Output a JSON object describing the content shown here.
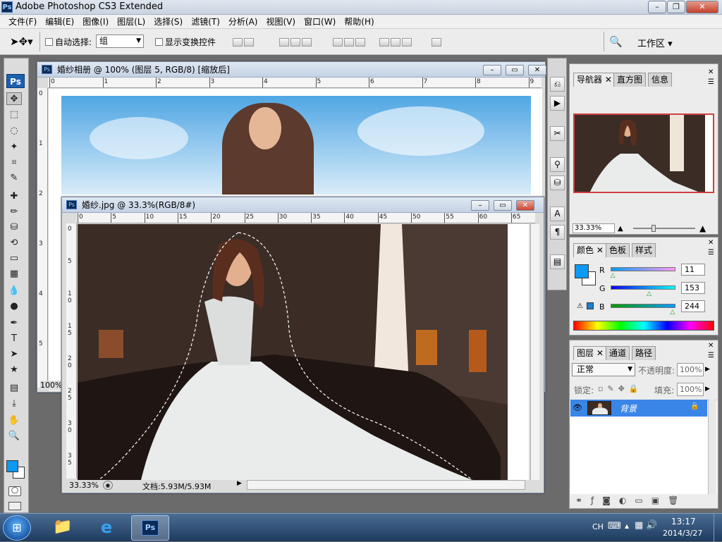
{
  "window": {
    "app_title": "Adobe Photoshop CS3 Extended",
    "logo_text": "Ps"
  },
  "menu": [
    "文件(F)",
    "编辑(E)",
    "图像(I)",
    "图层(L)",
    "选择(S)",
    "滤镜(T)",
    "分析(A)",
    "视图(V)",
    "窗口(W)",
    "帮助(H)"
  ],
  "options": {
    "auto_select_label": "自动选择:",
    "auto_select_value": "组",
    "show_transform_label": "显示变换控件",
    "workspace_label": "工作区"
  },
  "toolbox": {
    "badge": "Ps",
    "icons": [
      "move-tool-icon",
      "marquee-tool-icon",
      "lasso-tool-icon",
      "magic-wand-icon",
      "crop-tool-icon",
      "slice-tool-icon",
      "healing-brush-icon",
      "brush-tool-icon",
      "clone-stamp-icon",
      "history-brush-icon",
      "eraser-icon",
      "gradient-tool-icon",
      "blur-tool-icon",
      "dodge-tool-icon",
      "pen-tool-icon",
      "type-tool-icon",
      "path-select-icon",
      "shape-tool-icon",
      "notes-tool-icon",
      "eyedropper-icon",
      "hand-tool-icon",
      "zoom-tool-icon"
    ],
    "glyphs": [
      "✥",
      "⬚",
      "◌",
      "✦",
      "⌗",
      "✎",
      "✚",
      "✏",
      "⛁",
      "⟲",
      "▭",
      "▦",
      "💧",
      "●",
      "✒",
      "T",
      "➤",
      "★",
      "▤",
      "⤓",
      "✋",
      "🔍"
    ],
    "foreground_color": "#0b99f4",
    "background_color": "#ffffff"
  },
  "doc1": {
    "title": "婚纱相册 @ 100% (图层 5, RGB/8) [缩放后]",
    "zoom": "100%",
    "ruler_h": [
      "0",
      "1",
      "2",
      "3",
      "4",
      "5",
      "6",
      "7",
      "8",
      "9"
    ],
    "ruler_v": [
      "0",
      "1",
      "2",
      "3",
      "4",
      "5"
    ]
  },
  "doc2": {
    "title": "婚纱.jpg @ 33.3%(RGB/8#)",
    "zoom": "33.33%",
    "doc_info": "文档:5.93M/5.93M",
    "ruler_h": [
      "0",
      "5",
      "10",
      "15",
      "20",
      "25",
      "30",
      "35",
      "40",
      "45",
      "50",
      "55",
      "60",
      "65"
    ],
    "ruler_v": [
      "0",
      "5",
      "10",
      "15",
      "20",
      "25",
      "30",
      "35"
    ]
  },
  "navigator": {
    "tabs": [
      "导航器",
      "直方图",
      "信息"
    ],
    "zoom": "33.33%"
  },
  "color_panel": {
    "tabs": [
      "颜色",
      "色板",
      "样式"
    ],
    "labels": {
      "r": "R",
      "g": "G",
      "b": "B"
    },
    "values": {
      "r": "11",
      "g": "153",
      "b": "244"
    },
    "levels": {
      "r": 0.04,
      "g": 0.6,
      "b": 0.96
    },
    "swatch_color": "#0b99f4"
  },
  "layers": {
    "tabs": [
      "图层",
      "通道",
      "路径"
    ],
    "blend_mode": "正常",
    "opacity_label": "不透明度:",
    "opacity_value": "100%",
    "lock_label": "锁定:",
    "fill_label": "填充:",
    "fill_value": "100%",
    "layer_name": "背景"
  },
  "taskbar": {
    "lang": "CH",
    "time": "13:17",
    "date": "2014/3/27",
    "accent": "#1e3a5f"
  }
}
